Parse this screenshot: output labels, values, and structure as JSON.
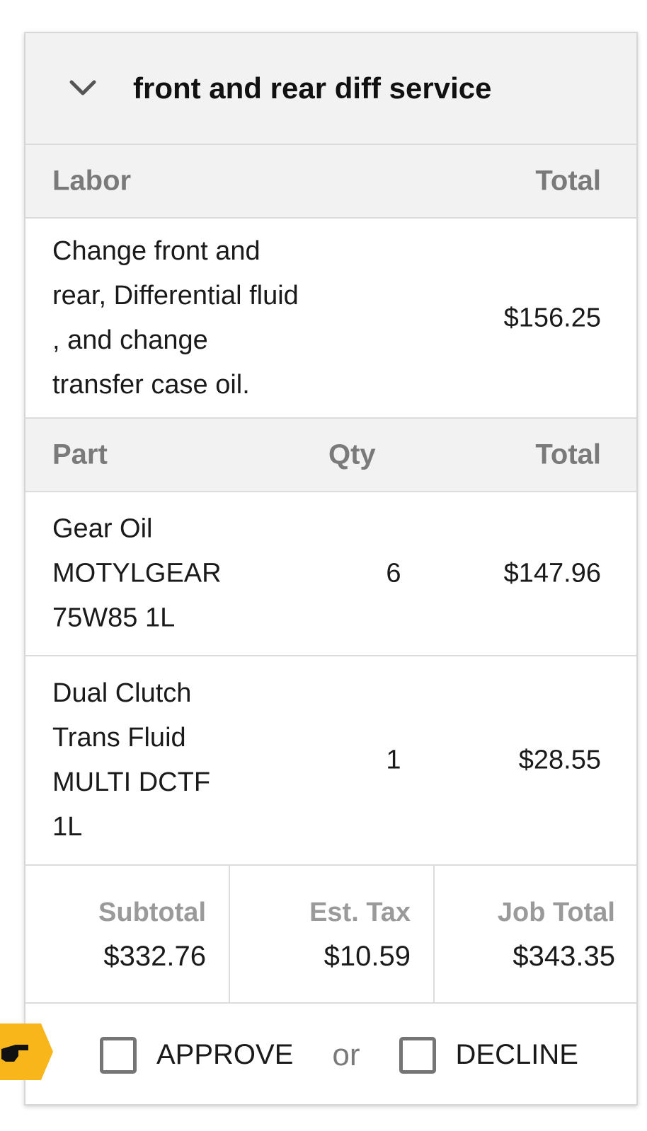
{
  "service": {
    "title": "front and rear diff service",
    "collapse_icon": "chevron-down-icon"
  },
  "labor": {
    "header_label": "Labor",
    "header_total": "Total",
    "description": "Change front and rear,  Differential fluid , and change transfer case oil.",
    "total": "$156.25"
  },
  "parts": {
    "header_part": "Part",
    "header_qty": "Qty",
    "header_total": "Total",
    "items": [
      {
        "name": "Gear Oil MOTYLGEAR 75W85 1L",
        "qty": "6",
        "total": "$147.96"
      },
      {
        "name": "Dual Clutch Trans Fluid MULTI DCTF 1L",
        "qty": "1",
        "total": "$28.55"
      }
    ]
  },
  "summary": {
    "subtotal_label": "Subtotal",
    "subtotal_value": "$332.76",
    "tax_label": "Est. Tax",
    "tax_value": "$10.59",
    "job_total_label": "Job Total",
    "job_total_value": "$343.35"
  },
  "actions": {
    "approve_label": "APPROVE",
    "or_label": "or",
    "decline_label": "DECLINE",
    "pointer_icon": "hand-pointer-icon",
    "pointer_color": "#f9b61b"
  }
}
